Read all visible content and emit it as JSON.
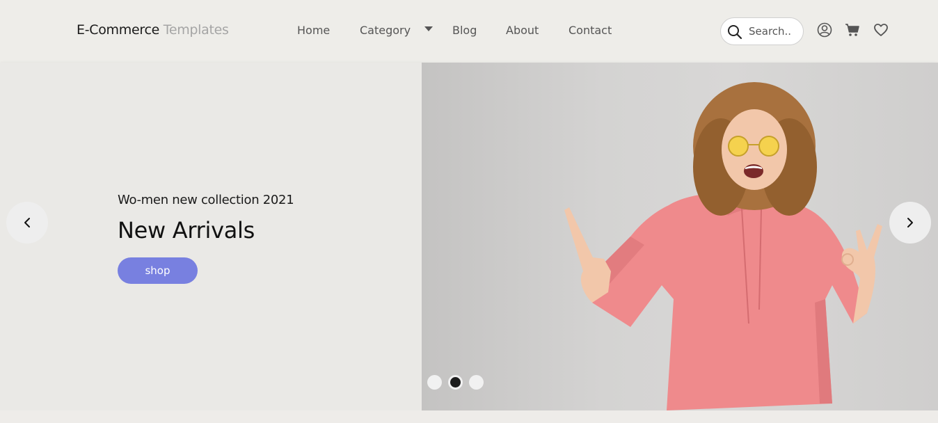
{
  "brand": {
    "main": "E-Commerce",
    "sub": " Templates"
  },
  "nav": {
    "items": [
      {
        "label": "Home"
      },
      {
        "label": "Category"
      },
      {
        "label": "Blog"
      },
      {
        "label": "About"
      },
      {
        "label": "Contact"
      }
    ]
  },
  "search": {
    "placeholder": "Search.."
  },
  "header_icons": [
    "user-icon",
    "cart-icon",
    "heart-icon"
  ],
  "hero": {
    "subtitle": "Wo-men new collection 2021",
    "title": "New Arrivals",
    "cta": "shop",
    "slides": 3,
    "active_slide": 2
  },
  "colors": {
    "accent": "#7880e0",
    "background": "#eeece9"
  }
}
